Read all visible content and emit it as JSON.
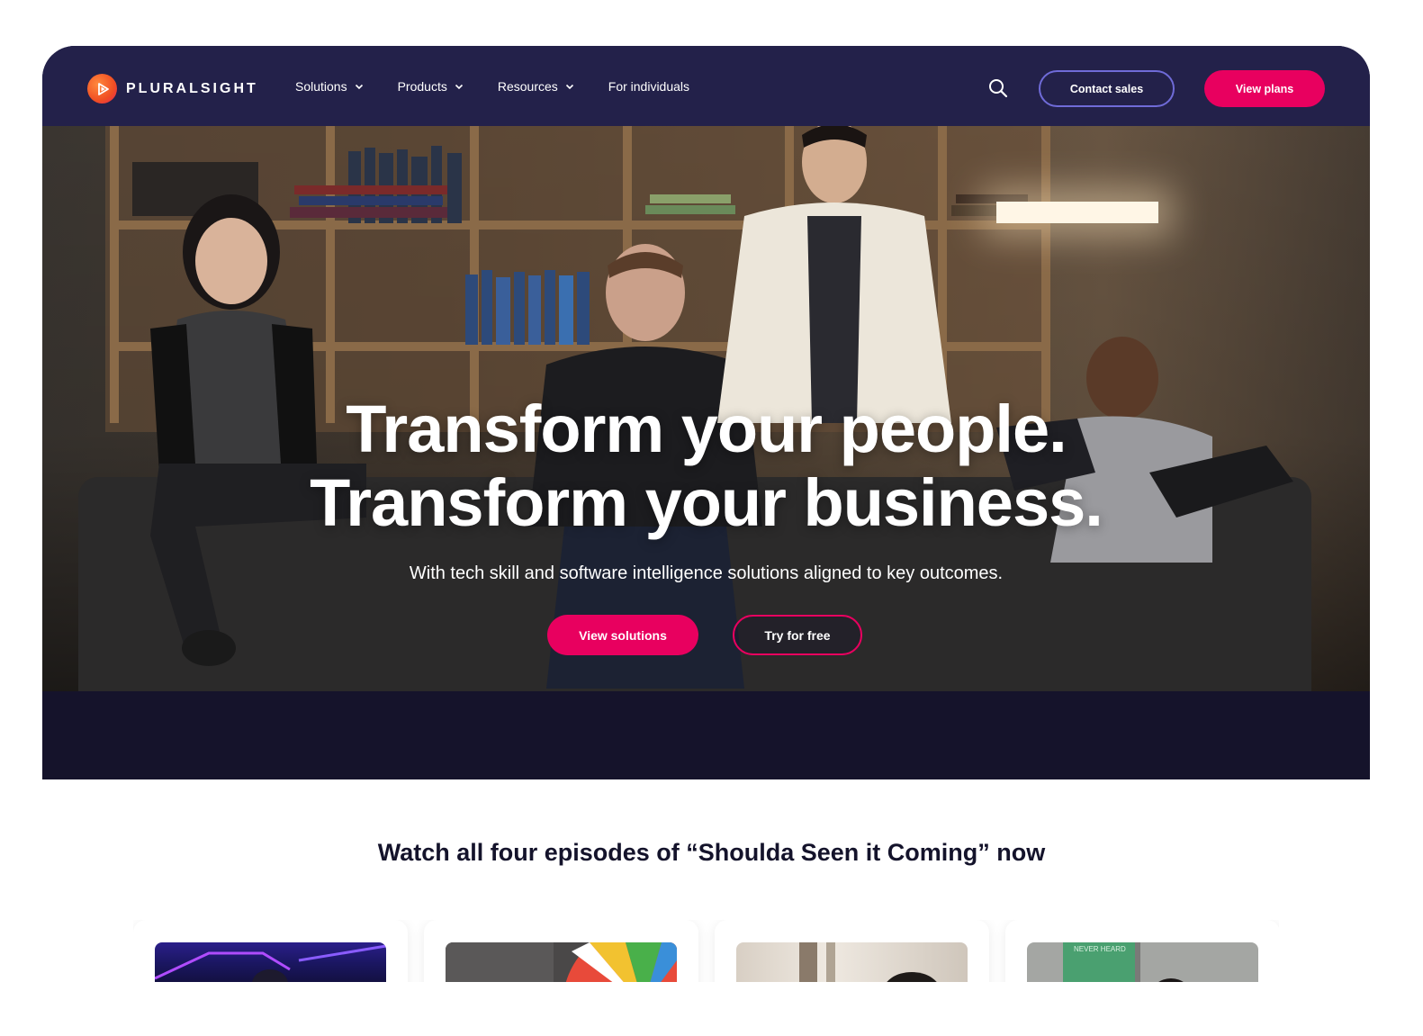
{
  "brand": {
    "name": "PLURALSIGHT",
    "accent": "#e8005f",
    "nav_bg": "#23214a",
    "hero_bottom_bg": "#15132b"
  },
  "nav": {
    "items": [
      {
        "label": "Solutions",
        "has_dropdown": true
      },
      {
        "label": "Products",
        "has_dropdown": true
      },
      {
        "label": "Resources",
        "has_dropdown": true
      },
      {
        "label": "For individuals",
        "has_dropdown": false
      }
    ],
    "search_icon": "search-icon",
    "contact_label": "Contact sales",
    "plans_label": "View plans"
  },
  "hero": {
    "title_line1": "Transform your people.",
    "title_line2": "Transform your business.",
    "subtitle": "With tech skill and software intelligence solutions aligned to key outcomes.",
    "primary_cta": "View solutions",
    "secondary_cta": "Try for free"
  },
  "episodes": {
    "heading": "Watch all four episodes of “Shoulda Seen it Coming” now",
    "cards": [
      {
        "thumb": "episode-1-thumbnail"
      },
      {
        "thumb": "episode-2-thumbnail"
      },
      {
        "thumb": "episode-3-thumbnail"
      },
      {
        "thumb": "episode-4-thumbnail",
        "thumb_text": "NEVER HEARD"
      }
    ]
  }
}
